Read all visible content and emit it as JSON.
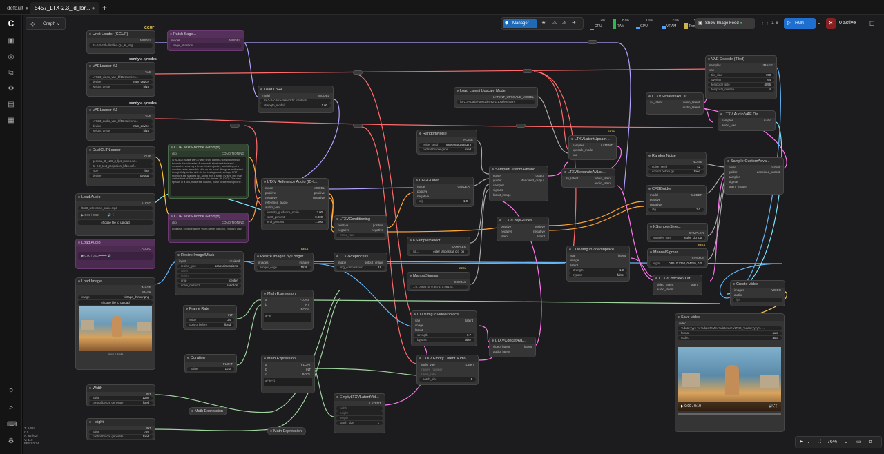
{
  "tabs": [
    {
      "label": "default"
    },
    {
      "label": "5457_LTX-2.3_ld_lor..."
    }
  ],
  "toolbar": {
    "graph_label": "Graph",
    "manager": "Manager",
    "show_feed": "Show Image Feed",
    "batch": "1",
    "run": "Run",
    "active": "0 active"
  },
  "stats": [
    {
      "label": "CPU",
      "value": "2%",
      "color": "#4da3ff",
      "level": 0.02
    },
    {
      "label": "RAM",
      "value": "87%",
      "color": "#2db84d",
      "level": 0.87
    },
    {
      "label": "GPU",
      "value": "16%",
      "color": "#4da3ff",
      "level": 0.16
    },
    {
      "label": "VRAM",
      "value": "23%",
      "color": "#4da3ff",
      "level": 0.23
    },
    {
      "label": "Temp",
      "value": "52°",
      "color": "#c9b54a",
      "level": 0.52
    }
  ],
  "footer": {
    "l1": "T: 0.00s",
    "l2": "I: 0",
    "l3": "N: 62 [62]",
    "l4": "V: 110",
    "l5": "FPS:83.34",
    "zoom": "76%"
  },
  "nodes": {
    "unet": {
      "title": "Unet Loader (GGUF)",
      "out": "MODEL",
      "w": "ltx-2-3-22b-distilled-Q4_K_M.g..."
    },
    "vae1": {
      "title": "VAELoader KJ",
      "out": "VAE",
      "w1": "LTX23_video_vae_bf16.safetens...",
      "w2k": "device",
      "w2": "main_device",
      "w3k": "weight_dtype",
      "w3": "bf16"
    },
    "vae2": {
      "title": "VAELoader KJ",
      "out": "VAE",
      "w1": "LTX23_audio_vae_bf16.safetens...",
      "w2k": "device",
      "w2": "main_device",
      "w3k": "weight_dtype",
      "w3": "bf16"
    },
    "clip": {
      "title": "DualCLIPLoader",
      "out": "CLIP",
      "w1": "gemma_3_12B_it_fp4_mixed.sa...",
      "w2": "ltx-2.3_text_projection_bf16.saf...",
      "w3k": "type",
      "w3": "ltxv",
      "w4k": "device",
      "w4": "default"
    },
    "loadaudio": {
      "title": "Load Audio",
      "out": "AUDIO",
      "w1": "ltx23_reference_audio.mp3",
      "time": "0:00 / 0:02",
      "btn": "choose file to upload"
    },
    "loadaudio2": {
      "title": "Load Audio",
      "out": "AUDIO",
      "time": "0:00 / 0:00"
    },
    "loadimage": {
      "title": "Load Image",
      "out1": "IMAGE",
      "out2": "MASK",
      "w1k": "image",
      "w1": "vintage_thinker.png",
      "btn": "choose file to upload",
      "cap": "1024 × 1536"
    },
    "width": {
      "title": "Width",
      "out": "INT",
      "w1k": "value",
      "w1": "1280",
      "w2k": "control before generate",
      "w2": "fixed"
    },
    "height": {
      "title": "Height",
      "out": "INT",
      "w1k": "value",
      "w1": "720",
      "w2k": "control before generate",
      "w2": "fixed"
    },
    "patch": {
      "title": "Patch Sage...",
      "in": "model",
      "out": "MODEL",
      "w": "sage_attention"
    },
    "lora": {
      "title": "Load LoRA",
      "in": "model",
      "out": "MODEL",
      "w1": "ltx-2-3-ic-lora-talkvid-3k.safetens...",
      "w2k": "strength_model",
      "w2": "1.00"
    },
    "clippos": {
      "title": "CLIP Text Encode (Prompt)",
      "in": "clip",
      "out": "CONDITIONING",
      "text": "[VISUAL]: Starts with a wide shot, camera slowly pushes in towards the character. A man with short dark hair and mustache, wearing a brown leather jacket, and sitting at a wooden table, rests his chin on his hand. His gaze is directed thoughtfully, to the side. In the background, vintage CRT monitors are stacked up, along with a small TV set. The man on the front of this shelf fixes the viewer. [AUDIO]: The man speaks in a low, moderate volume, close to the microphone."
    },
    "clipneg": {
      "title": "CLIP Text Encode (Prompt)",
      "in": "clip",
      "out": "CONDITIONING",
      "text": "pc game, console game, video game, cartoon, childish, ugly"
    },
    "refaudio": {
      "title": "LTXV Reference Audio (ID-L...",
      "in1": "model",
      "in2": "positive",
      "in3": "negative",
      "in4": "reference_audio",
      "in5": "audio_vae",
      "out1": "MODEL",
      "out2": "positive",
      "out3": "negative",
      "w1k": "identity_guidance_scale",
      "w1": "3.00",
      "w2k": "start_percent",
      "w2": "0.000",
      "w3k": "end_percent",
      "w3": "1.000"
    },
    "resizemask": {
      "title": "Resize Image/Mask",
      "in": "input",
      "out": "resized",
      "w1k": "resize_type",
      "w1": "scale dimensions",
      "w2k": "width",
      "w3k": "height",
      "w4k": "crop",
      "w4": "center",
      "w5k": "scale_method",
      "w5": "lanczos"
    },
    "resizelong": {
      "title": "Resize Images by Longer...",
      "in": "images",
      "out": "images",
      "w1k": "longer_edge",
      "w1": "1536"
    },
    "framerate": {
      "title": "Frame Rate",
      "out": "INT",
      "w1k": "value",
      "w1": "24",
      "w2k": "control before",
      "w2": "fixed"
    },
    "duration": {
      "title": "Duration",
      "out": "FLOAT",
      "w1k": "value",
      "w1": "10.0"
    },
    "math1": {
      "title": "Math Expression",
      "in1": "a",
      "in2": "b",
      "out1": "FLOAT",
      "out2": "INT",
      "out3": "BOOL",
      "expr": "a * b"
    },
    "math2": {
      "title": "Math Expression",
      "in1": "a",
      "in2": "b",
      "in3": "c",
      "out1": "FLOAT",
      "out2": "INT",
      "out3": "BOOL",
      "expr": "a * b + 1"
    },
    "math3": {
      "title": "Math Expression"
    },
    "math4": {
      "title": "Math Expression"
    },
    "ltxcond": {
      "title": "LTXVConditioning",
      "in1": "positive",
      "in2": "negative",
      "in3": "frame_rate",
      "out1": "positive",
      "out2": "negative"
    },
    "preprocess": {
      "title": "LTXVPreprocess",
      "in": "image",
      "out": "output_image",
      "w1k": "img_compression",
      "w1": "18"
    },
    "cfg1": {
      "title": "CFGGuider",
      "in1": "model",
      "in2": "positive",
      "in3": "negative",
      "out": "GUIDER",
      "w1k": "cfg",
      "w1": "1.0"
    },
    "ksel1": {
      "title": "KSamplerSelect",
      "out": "SAMPLER",
      "w1k": "sa...",
      "w1": "euler_ancestral_cfg_pp"
    },
    "sigmas1": {
      "title": "ManualSigmas",
      "out": "SIGMAS",
      "w1": "1.0, 0.99375, 0.9875, 0.98125,"
    },
    "noise1": {
      "title": "RandomNoise",
      "out": "NOISE",
      "w1k": "noise_seed",
      "w1": "880646492488373",
      "w2k": "control before gene",
      "w2": "fixed"
    },
    "adv1": {
      "title": "SamplerCustomAdvanc...",
      "in1": "noise",
      "in2": "guider",
      "in3": "sampler",
      "in4": "sigmas",
      "in5": "latent_image",
      "out1": "output",
      "out2": "denoised_output"
    },
    "crop": {
      "title": "LTXVCropGuides",
      "in1": "positive",
      "in2": "negative",
      "in3": "latent",
      "out1": "positive",
      "out2": "negative",
      "out3": "latent"
    },
    "imginplace1": {
      "title": "LTXVImgToVideoInplace",
      "in1": "vae",
      "in2": "image",
      "in3": "latent",
      "out": "latent",
      "w1k": "strength",
      "w1": "0.7",
      "w2k": "bypass",
      "w2": "false"
    },
    "concat1": {
      "title": "LTXVConcatAVL...",
      "in1": "video_latent",
      "in2": "audio_latent",
      "out": "latent"
    },
    "emptyaudio": {
      "title": "LTXV Empty Latent Audio",
      "in1": "audio_vae",
      "in2": "frames_number",
      "in3": "frame_rate",
      "out": "Latent",
      "w1k": "batch_size",
      "w1": "1"
    },
    "emptyltx": {
      "title": "EmptyLTXVLatentVid...",
      "in1": "width",
      "in2": "height",
      "in3": "length",
      "out": "LATENT",
      "w1k": "batch_size",
      "w1": "1"
    },
    "upscaleload": {
      "title": "Load Latent Upscale Model",
      "out": "LATENT_UPSCALE_MODEL",
      "w1": "ltx-2.3-spatial-upscaler-x2-1.1.safetensors"
    },
    "upsampler": {
      "title": "LTXVLatentUpsam...",
      "in1": "samples",
      "in2": "upscale_model",
      "in3": "vae",
      "out": "LATENT",
      "beta": "BETA"
    },
    "separate1": {
      "title": "LTXVSeparateAVLat...",
      "in": "av_latent",
      "out1": "video_latent",
      "out2": "audio_latent"
    },
    "separate2": {
      "title": "LTXVSeparateAVLat...",
      "in": "av_latent",
      "out1": "video_latent",
      "out2": "audio_latent"
    },
    "imginplace2": {
      "title": "LTXVImgToVideoInplace",
      "in1": "vae",
      "in2": "image",
      "in3": "latent",
      "out": "latent",
      "w1k": "strength",
      "w1": "1.0",
      "w2k": "bypass",
      "w2": "false"
    },
    "concat2": {
      "title": "LTXVConcatAVLat...",
      "in1": "video_latent",
      "in2": "audio_latent",
      "out": "latent"
    },
    "vaedecode": {
      "title": "VAE Decode (Tiled)",
      "in1": "samples",
      "in2": "vae",
      "out": "IMAGE",
      "w1k": "tile_size",
      "w1": "768",
      "w2k": "overlap",
      "w2": "64",
      "w3k": "temporal_size",
      "w3": "4096",
      "w4k": "temporal_overlap",
      "w4": "4"
    },
    "audiodecode": {
      "title": "LTXV Audio VAE De...",
      "in1": "samples",
      "in2": "audio_vae",
      "out": "Audio"
    },
    "noise2": {
      "title": "RandomNoise",
      "out": "NOISE",
      "w1k": "noise_seed",
      "w1": "42",
      "w2k": "control before ge",
      "w2": "fixed"
    },
    "cfg2": {
      "title": "CFGGuider",
      "in1": "model",
      "in2": "positive",
      "in3": "negative",
      "out": "GUIDER",
      "w1k": "cfg",
      "w1": "1.0"
    },
    "ksel2": {
      "title": "KSamplerSelect",
      "out": "SAMPLER",
      "w1k": "sampler_nam",
      "w1": "euler_cfg_pp"
    },
    "sigmas2": {
      "title": "ManualSigmas",
      "out": "SIGMAS",
      "w1k": "sigm",
      "w1": "0.85, 0.7250, 0.4219, 0.0"
    },
    "adv2": {
      "title": "SamplerCustomAdva...",
      "in1": "noise",
      "in2": "guider",
      "in3": "sampler",
      "in4": "sigmas",
      "in5": "latent_image",
      "out1": "output",
      "out2": "denoised_output"
    },
    "createvideo": {
      "title": "Create Video",
      "in1": "images",
      "in2": "audio",
      "in3": "fps",
      "out": "VIDEO"
    },
    "savevideo": {
      "title": "Save Video",
      "in": "video",
      "w1": "%date:yyyy-%-%date:MM%-%date:dd%/LTX2_%date:yyyy%-...",
      "w2k": "format",
      "w2": "auto",
      "w3k": "codec",
      "w3": "auto",
      "time": "0:00 / 0:10"
    }
  },
  "labels": {
    "gguf": "GGUF",
    "comfy1": "comfyui-kjnodes",
    "comfy2": "comfyui-kjnodes",
    "beta": "BETA"
  }
}
